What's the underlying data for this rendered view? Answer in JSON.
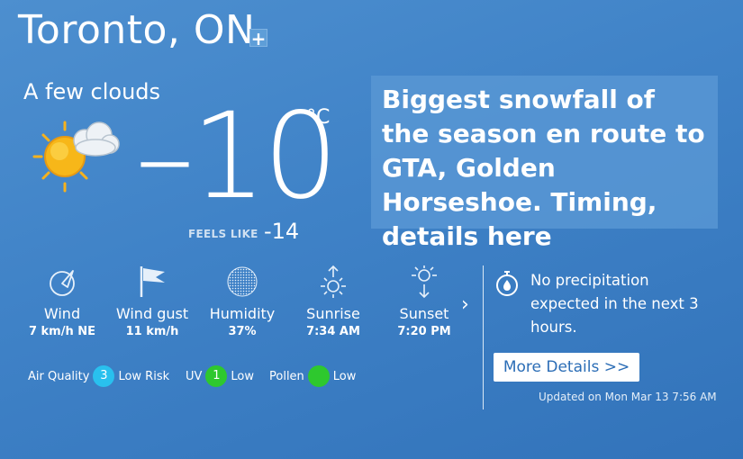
{
  "location": {
    "city": "Toronto, ON",
    "add_label": "+"
  },
  "current": {
    "condition": "A few clouds",
    "temperature": "–10",
    "unit": "°C",
    "feels_like_label": "FEELS LIKE",
    "feels_like_value": "-14",
    "icon": "sun-cloud-icon"
  },
  "news": {
    "headline": "Biggest snowfall of the season en route to GTA, Golden Horseshoe. Timing, details here"
  },
  "stats": [
    {
      "label": "Wind",
      "value": "7 km/h NE",
      "icon": "wind-icon"
    },
    {
      "label": "Wind gust",
      "value": "11 km/h",
      "icon": "flag-icon"
    },
    {
      "label": "Humidity",
      "value": "37%",
      "icon": "humidity-icon"
    },
    {
      "label": "Sunrise",
      "value": "7:34 AM",
      "icon": "sunrise-icon"
    },
    {
      "label": "Sunset",
      "value": "7:20 PM",
      "icon": "sunset-icon"
    }
  ],
  "indices": {
    "air_quality": {
      "label": "Air Quality",
      "value": "3",
      "status": "Low Risk",
      "color": "#29c0ee"
    },
    "uv": {
      "label": "UV",
      "value": "1",
      "status": "Low",
      "color": "#2ec82e"
    },
    "pollen": {
      "label": "Pollen",
      "value": "",
      "status": "Low",
      "color": "#2ec82e"
    }
  },
  "precipitation": {
    "text": "No precipitation expected in the next 3 hours.",
    "icon": "stopwatch-drop-icon"
  },
  "more_details_label": "More Details >>",
  "updated": "Updated on Mon Mar 13 7:56 AM",
  "chevron_label": "›"
}
